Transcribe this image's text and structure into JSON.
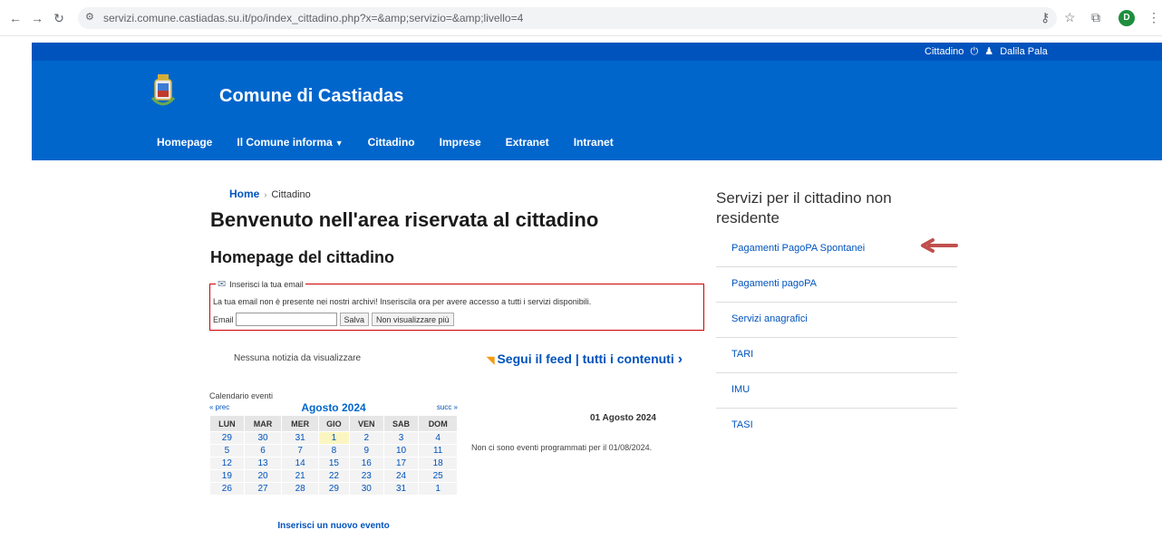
{
  "browser": {
    "url": "servizi.comune.castiadas.su.it/po/index_cittadino.php?x=&amp;servizio=&amp;livello=4",
    "profile_initial": "D"
  },
  "topbar": {
    "role": "Cittadino",
    "user": "Dalila Pala"
  },
  "header": {
    "title": "Comune di Castiadas",
    "nav": [
      "Homepage",
      "Il Comune informa",
      "Cittadino",
      "Imprese",
      "Extranet",
      "Intranet"
    ]
  },
  "breadcrumb": {
    "home": "Home",
    "current": "Cittadino"
  },
  "page": {
    "title": "Benvenuto nell'area riservata al cittadino",
    "subtitle": "Homepage del cittadino"
  },
  "email_box": {
    "legend": "Inserisci la tua email",
    "message": "La tua email non è presente nei nostri archivi! Inseriscila ora per avere accesso a tutti i servizi disponibili.",
    "label": "Email",
    "value": "",
    "save_label": "Salva",
    "hide_label": "Non visualizzare più"
  },
  "news": {
    "empty": "Nessuna notizia da visualizzare",
    "feed_label": "Segui il feed",
    "all_label": "tutti i contenuti"
  },
  "calendar": {
    "label": "Calendario eventi",
    "prev": "« prec",
    "month": "Agosto 2024",
    "next": "succ »",
    "days": [
      "LUN",
      "MAR",
      "MER",
      "GIO",
      "VEN",
      "SAB",
      "DOM"
    ],
    "weeks": [
      [
        "29",
        "30",
        "31",
        "1",
        "2",
        "3",
        "4"
      ],
      [
        "5",
        "6",
        "7",
        "8",
        "9",
        "10",
        "11"
      ],
      [
        "12",
        "13",
        "14",
        "15",
        "16",
        "17",
        "18"
      ],
      [
        "19",
        "20",
        "21",
        "22",
        "23",
        "24",
        "25"
      ],
      [
        "26",
        "27",
        "28",
        "29",
        "30",
        "31",
        "1"
      ]
    ],
    "new_event": "Inserisci un nuovo evento",
    "day_title": "01 Agosto 2024",
    "no_events": "Non ci sono eventi programmati per il 01/08/2024."
  },
  "sidebar": {
    "title": "Servizi per il cittadino non residente",
    "items": [
      "Pagamenti PagoPA Spontanei",
      "Pagamenti pagoPA",
      "Servizi anagrafici",
      "TARI",
      "IMU",
      "TASI"
    ]
  },
  "colors": {
    "brand": "#0066cc",
    "topbar": "#0053bd",
    "alert_border": "#cc0000",
    "today": "#fbf6c1",
    "annotation_arrow": "#c0504d"
  }
}
